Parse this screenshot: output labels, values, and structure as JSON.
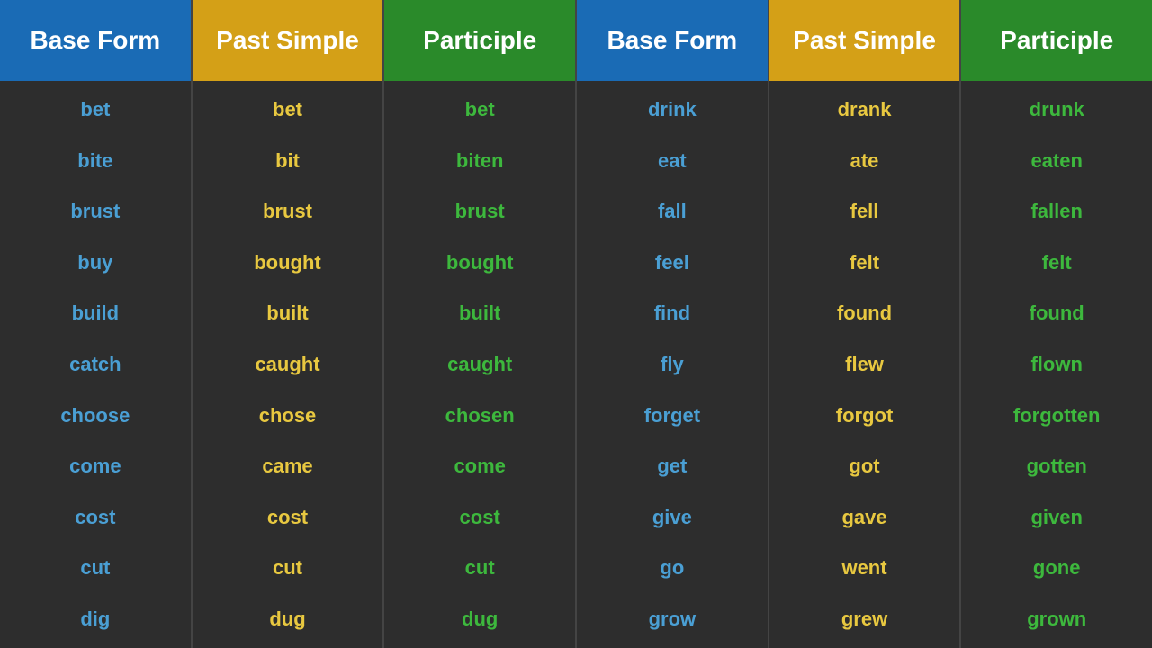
{
  "columns": [
    {
      "header": "Base Form",
      "headerClass": "header-blue",
      "cellColor": "color-blue",
      "words": [
        "bet",
        "bite",
        "brust",
        "buy",
        "build",
        "catch",
        "choose",
        "come",
        "cost",
        "cut",
        "dig"
      ]
    },
    {
      "header": "Past Simple",
      "headerClass": "header-yellow",
      "cellColor": "color-yellow",
      "words": [
        "bet",
        "bit",
        "brust",
        "bought",
        "built",
        "caught",
        "chose",
        "came",
        "cost",
        "cut",
        "dug"
      ]
    },
    {
      "header": "Participle",
      "headerClass": "header-green",
      "cellColor": "color-green",
      "words": [
        "bet",
        "biten",
        "brust",
        "bought",
        "built",
        "caught",
        "chosen",
        "come",
        "cost",
        "cut",
        "dug"
      ]
    },
    {
      "header": "Base Form",
      "headerClass": "header-blue",
      "cellColor": "color-blue",
      "words": [
        "drink",
        "eat",
        "fall",
        "feel",
        "find",
        "fly",
        "forget",
        "get",
        "give",
        "go",
        "grow"
      ]
    },
    {
      "header": "Past Simple",
      "headerClass": "header-yellow",
      "cellColor": "color-yellow",
      "words": [
        "drank",
        "ate",
        "fell",
        "felt",
        "found",
        "flew",
        "forgot",
        "got",
        "gave",
        "went",
        "grew"
      ]
    },
    {
      "header": "Participle",
      "headerClass": "header-green",
      "cellColor": "color-green",
      "words": [
        "drunk",
        "eaten",
        "fallen",
        "felt",
        "found",
        "flown",
        "forgotten",
        "gotten",
        "given",
        "gone",
        "grown"
      ]
    }
  ]
}
